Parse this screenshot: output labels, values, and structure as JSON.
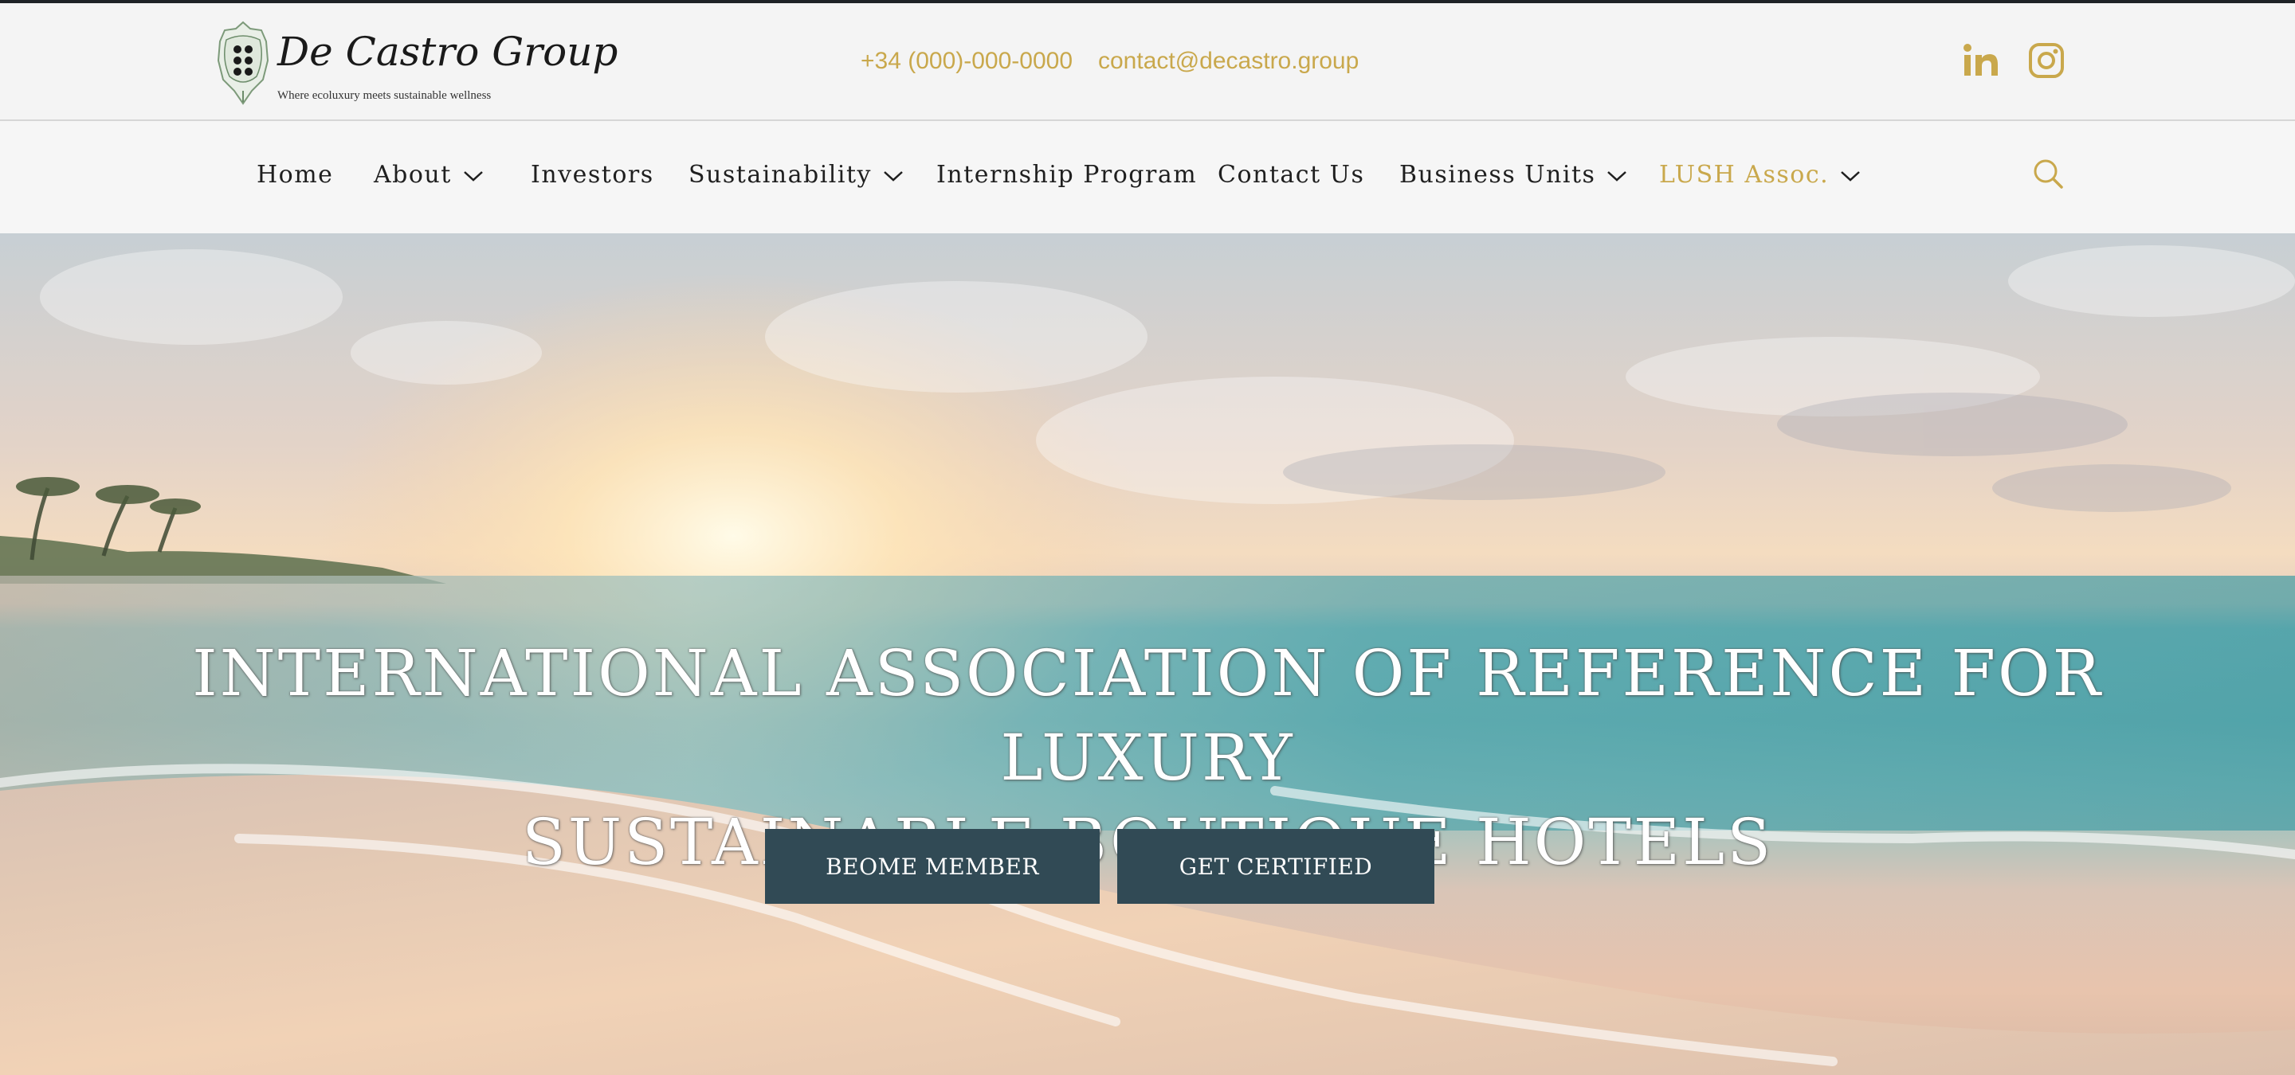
{
  "colors": {
    "accent_gold": "#c9a84c",
    "button_bg": "#314a55",
    "nav_text": "#1f1f1f"
  },
  "header": {
    "logo_name": "De Castro Group",
    "logo_tagline": "Where ecoluxury meets sustainable wellness",
    "phone": "+34 (000)-000-0000",
    "email": "contact@decastro.group",
    "social_icons": [
      "linkedin-icon",
      "instagram-icon"
    ]
  },
  "nav": {
    "items": [
      {
        "label": "Home",
        "has_dropdown": false
      },
      {
        "label": "About",
        "has_dropdown": true
      },
      {
        "label": "Investors",
        "has_dropdown": false
      },
      {
        "label": "Sustainability",
        "has_dropdown": true
      },
      {
        "label": "Internship Program",
        "has_dropdown": false
      },
      {
        "label": "Contact Us",
        "has_dropdown": false
      },
      {
        "label": "Business Units",
        "has_dropdown": true
      },
      {
        "label": "LUSH Assoc.",
        "has_dropdown": true,
        "active": true
      }
    ],
    "search_icon": "search-icon"
  },
  "hero": {
    "title_line1": "INTERNATIONAL ASSOCIATION OF REFERENCE FOR LUXURY",
    "title_line2": "SUSTAINABLE BOUTIQUE HOTELS",
    "member_button": "BEOME MEMBER",
    "certified_button": "GET CERTIFIED"
  }
}
